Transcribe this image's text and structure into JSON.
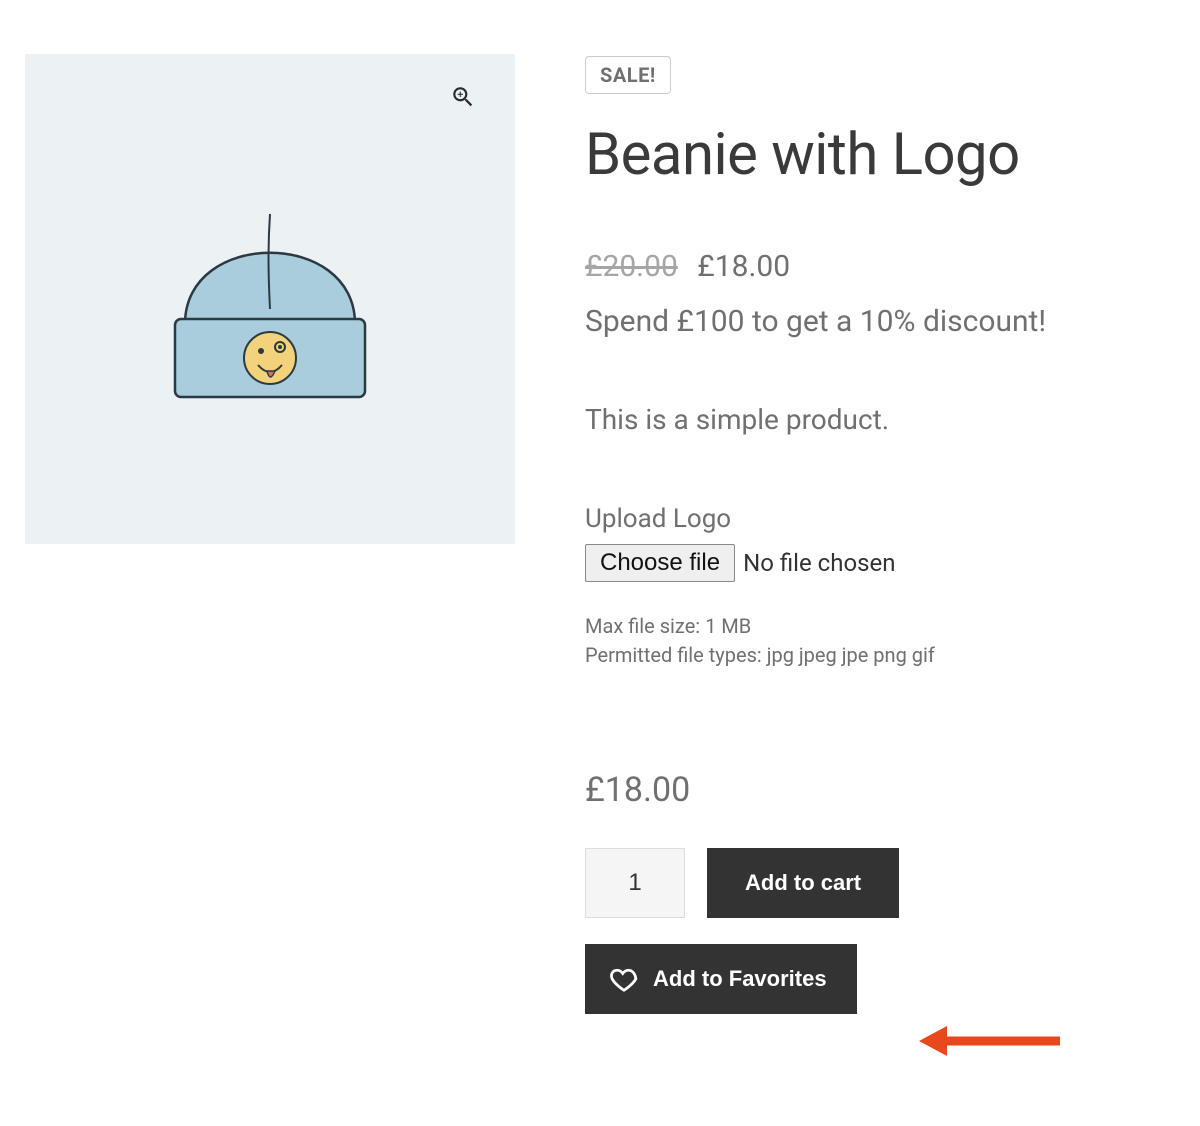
{
  "sale_badge": "SALE!",
  "product_title": "Beanie with Logo",
  "price": {
    "currency": "£",
    "original": "20.00",
    "sale": "18.00"
  },
  "promo_text": "Spend £100 to get a 10% discount!",
  "short_description": "This is a simple product.",
  "upload": {
    "label": "Upload Logo",
    "choose_button": "Choose file",
    "status": "No file chosen",
    "hint_size": "Max file size: 1 MB",
    "hint_types": "Permitted file types: jpg jpeg jpe png gif"
  },
  "final_price": "£18.00",
  "quantity_value": "1",
  "buttons": {
    "add_to_cart": "Add to cart",
    "add_to_favorites": "Add to Favorites"
  },
  "icons": {
    "zoom": "zoom-icon",
    "heart": "heart-icon"
  }
}
